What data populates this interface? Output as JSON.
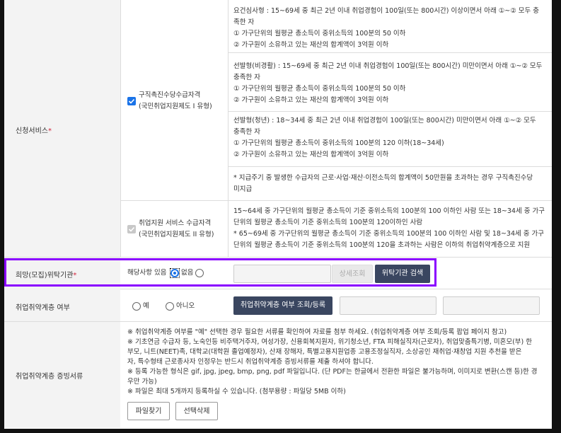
{
  "service": {
    "label": "신청서비스",
    "required_mark": "*",
    "option1": {
      "title_line1": "구직촉진수당수급자격",
      "title_line2": "(국민취업지원제도 I 유형)",
      "checked": true,
      "blocks": [
        [
          "요건심사형 : 15~69세 중 최근 2년 이내 취업경험이 100일(또는 800시간) 이상이면서 아래 ①~② 모두 충",
          "족한 자",
          "① 가구단위의 월평균 총소득이 중위소득의 100분의 50 이하",
          "② 가구원이 소유하고 있는 재산의 합계액이 3억원 이하"
        ],
        [
          "선발형(비경활) : 15~69세 중 최근 2년 이내 취업경험이 100일(또는 800시간) 미만이면서 아래 ①~② 모두",
          "충족한 자",
          "① 가구단위의 월평균 총소득이 중위소득의 100분의 50 이하",
          "② 가구원이 소유하고 있는 재산의 합계액이 3억원 이하"
        ],
        [
          "선발형(청년) : 18~34세 중 최근 2년 이내 취업경험이 100일(또는 800시간) 미만이면서 아래 ①~② 모두",
          "충족한 자",
          "① 가구단위의 월평균 총소득이 중위소득의 100분의 120 이하(18~34세)",
          "② 가구원이 소유하고 있는 재산의 합계액이 3억원 이하"
        ],
        [
          "* 지급주기 중 발생한 수급자의 근로·사업·재산·이전소득의 합계액이 50만원을 초과하는 경우 구직촉진수당",
          "미지급"
        ]
      ]
    },
    "option2": {
      "title_line1": "취업지원 서비스 수급자격",
      "title_line2": "(국민취업지원제도 II 유형)",
      "checked": true,
      "disabled": true,
      "lines": [
        "15~64세 중 가구단위의 월평균 총소득이 기준 중위소득의 100분의 100 이하인 사람 또는 18~34세 중 가구",
        "단위의 월평균 총소득이 기준 중위소득의 100분의 120이하인 사람",
        "* 65~69세 중 가구단위의 월평균 총소득이 기준 중위소득의 100분의 100 이하인 사람 및 18~34세 중 가구",
        "단위의 월평균 총소득이 기준 중위소득의 100분의 120을 초과하는 사람은 이하의 취업취약계층으로 지원"
      ]
    }
  },
  "agency": {
    "label": "희망(모집)위탁기관",
    "required_mark": "*",
    "yes_label": "해당사항 있음",
    "no_label": "없음",
    "selected": "yes",
    "detail_button": "상세조회",
    "search_button": "위탁기관 검색"
  },
  "vulnerable": {
    "label": "취업취약계층 여부",
    "yes_label": "예",
    "no_label": "아니오",
    "lookup_button": "취업취약계층 여부 조회/등록"
  },
  "proof": {
    "label": "취업취약계층 증빙서류",
    "notes": [
      "※ 취업취약계층 여부를 \"예\" 선택한 경우 필요한 서류를 확인하여 자료를 첨부 하세요. (취업취약계층 여부 조회/등록 팝업 페이지 참고)",
      "※ 기초연금 수급자 등, 노숙인등 비주택거주자, 여성가장, 신용회복지원자, 위기청소년, FTA 피해실직자(근로자), 취업맞춤특기병, 미혼모(부) 한",
      "부모, 니트(NEET)족, 대학교(대학원 졸업예정자), 산재 장해자, 특별고용지원업종 고용조정실직자, 소상공인 재취업·재창업 지원 추천을 받은",
      "자, 특수형태 근로종사자 인정우는 반드시 취업취약계층 증빙서류를 제출 하셔야 합니다.",
      "※ 등록 가능한 형식은 gif, jpg, jpeg, bmp, png, pdf 파일입니다. (단 PDF는 한글에서 전환한 파일은 불가능하며, 이미지로 변환(스캔 등)한 경",
      "우만 가능)",
      "※ 파일은 최대 5개까지 등록하실 수 있습니다. (첨부용량 : 파일당 5MB 이하)"
    ],
    "find_button": "파일찾기",
    "delete_button": "선택삭제"
  },
  "colors": {
    "accent": "#1a73e8",
    "highlight": "#8a00ff",
    "dark_button": "#3a4660",
    "required": "#d2233b"
  }
}
